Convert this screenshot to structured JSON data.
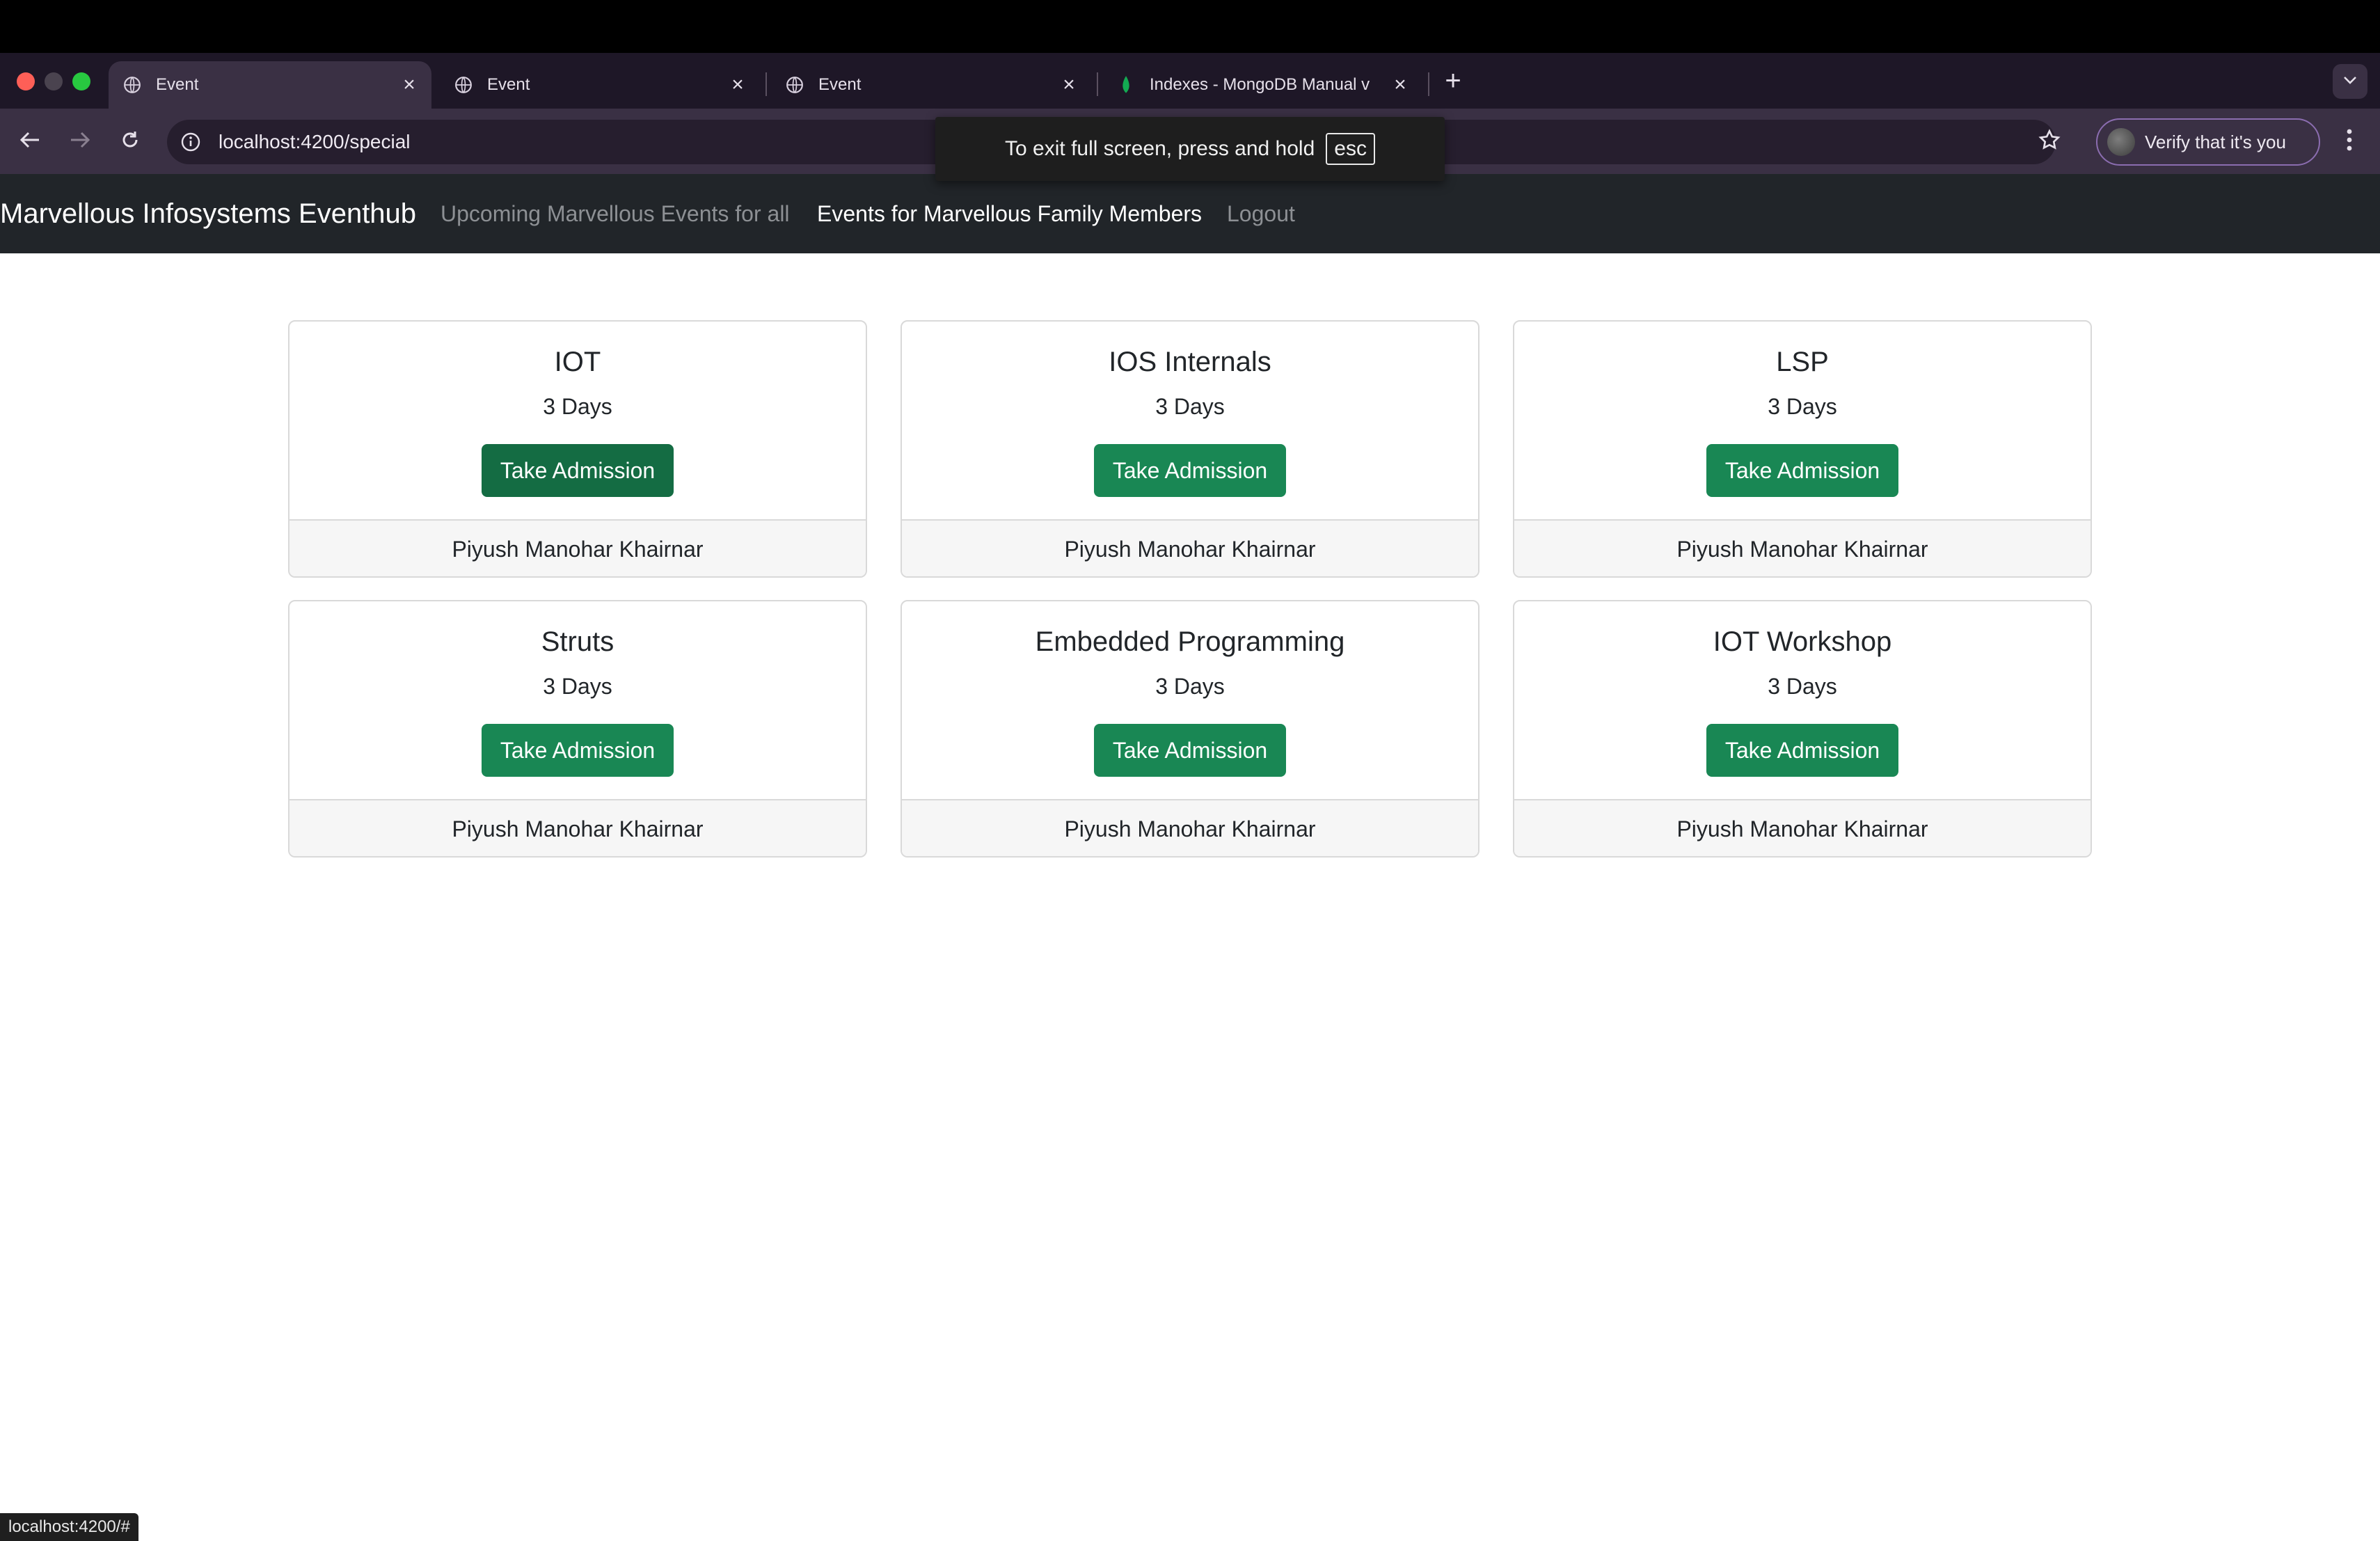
{
  "browser": {
    "tabs": [
      {
        "title": "Event",
        "active": true
      },
      {
        "title": "Event",
        "active": false
      },
      {
        "title": "Event",
        "active": false
      },
      {
        "title": "Indexes - MongoDB Manual v",
        "active": false
      }
    ],
    "new_tab_symbol": "+",
    "url": "localhost:4200/special",
    "verify_label": "Verify that it's you",
    "fullscreen_hint": "To exit full screen, press and hold",
    "fullscreen_key": "esc",
    "status_url": "localhost:4200/#",
    "colors": {
      "tab_bar": "#1e1727",
      "toolbar": "#3a3044",
      "accent": "#8b6db0"
    }
  },
  "navbar": {
    "brand": "Marvellous Infosystems Eventhub",
    "links": [
      {
        "label": "Upcoming Marvellous Events for all",
        "active": false
      },
      {
        "label": "Events for Marvellous Family Members",
        "active": true
      },
      {
        "label": "Logout",
        "active": false
      }
    ]
  },
  "events": [
    {
      "title": "IOT",
      "duration": "3 Days",
      "button": "Take Admission",
      "instructor": "Piyush Manohar Khairnar"
    },
    {
      "title": "IOS Internals",
      "duration": "3 Days",
      "button": "Take Admission",
      "instructor": "Piyush Manohar Khairnar"
    },
    {
      "title": "LSP",
      "duration": "3 Days",
      "button": "Take Admission",
      "instructor": "Piyush Manohar Khairnar"
    },
    {
      "title": "Struts",
      "duration": "3 Days",
      "button": "Take Admission",
      "instructor": "Piyush Manohar Khairnar"
    },
    {
      "title": "Embedded Programming",
      "duration": "3 Days",
      "button": "Take Admission",
      "instructor": "Piyush Manohar Khairnar"
    },
    {
      "title": "IOT Workshop",
      "duration": "3 Days",
      "button": "Take Admission",
      "instructor": "Piyush Manohar Khairnar"
    }
  ],
  "colors": {
    "button_green": "#198754",
    "navbar_dark": "#212529"
  }
}
